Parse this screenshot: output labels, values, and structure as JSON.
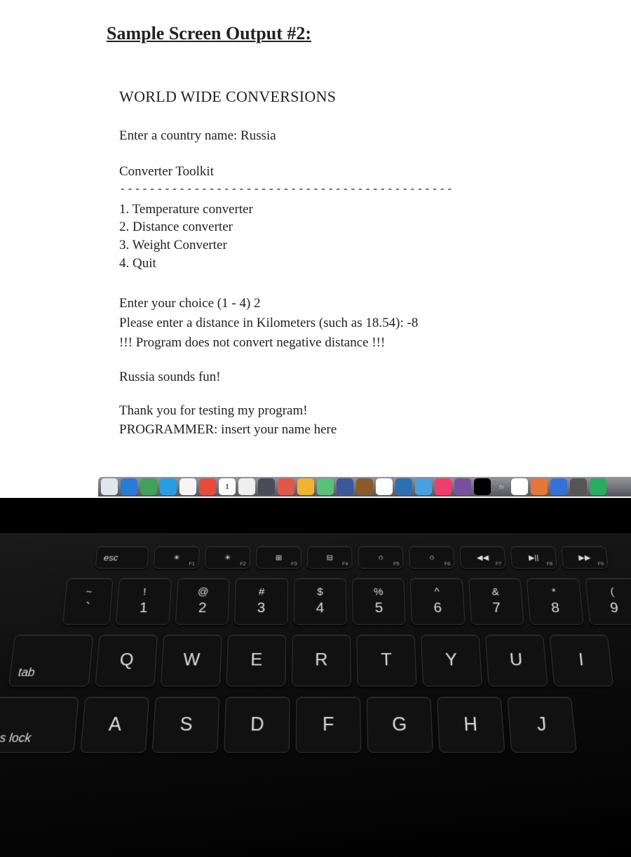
{
  "doc": {
    "title": "Sample Screen Output #2:",
    "app_title": "WORLD WIDE CONVERSIONS",
    "prompt_country": "Enter a country name: Russia",
    "toolkit_header": "Converter Toolkit",
    "dashes": "---------------------------------------------",
    "menu": [
      "1. Temperature converter",
      "2. Distance converter",
      "3. Weight Converter",
      "4. Quit"
    ],
    "choice_line": "Enter your choice (1 - 4) 2",
    "distance_prompt": "Please enter a distance in Kilometers (such as 18.54): -8",
    "error_line": "!!! Program does not convert negative distance !!!",
    "fun_line": "Russia sounds fun!",
    "thanks_line": "Thank you for testing my program!",
    "programmer_line": "PROGRAMMER: insert your name here"
  },
  "dock": {
    "tv_label": "tv",
    "icons": [
      {
        "bg": "#dfe6ee"
      },
      {
        "bg": "#2a7bd6"
      },
      {
        "bg": "#3fa15a"
      },
      {
        "bg": "#2a9de0"
      },
      {
        "bg": "#f5f5f5"
      },
      {
        "bg": "#e84b3c"
      },
      {
        "bg": "#fff",
        "txt": "1"
      },
      {
        "bg": "#eee"
      },
      {
        "bg": "#4a4a58"
      },
      {
        "bg": "#e2574c"
      },
      {
        "bg": "#f2b330"
      },
      {
        "bg": "#59c178"
      },
      {
        "bg": "#3b5998"
      },
      {
        "bg": "#8b5a2b"
      },
      {
        "bg": "#fff"
      },
      {
        "bg": "#2c6fb3"
      },
      {
        "bg": "#48a0dc"
      },
      {
        "bg": "#ef3e6d"
      },
      {
        "bg": "#7a4fa0"
      },
      {
        "bg": "#000"
      },
      {
        "bg": "#fff"
      },
      {
        "bg": "#e57838"
      },
      {
        "bg": "#3672d6"
      },
      {
        "bg": "#555"
      },
      {
        "bg": "#2aad5e"
      }
    ]
  },
  "keyboard": {
    "fn_row": [
      {
        "main": "esc",
        "sub": "",
        "cls": "esc"
      },
      {
        "main": "☀",
        "sub": "F1"
      },
      {
        "main": "☀",
        "sub": "F2"
      },
      {
        "main": "⊞",
        "sub": "F3"
      },
      {
        "main": "⊟",
        "sub": "F4"
      },
      {
        "main": "☼",
        "sub": "F5"
      },
      {
        "main": "☼",
        "sub": "F6"
      },
      {
        "main": "◀◀",
        "sub": "F7"
      },
      {
        "main": "▶||",
        "sub": "F8"
      },
      {
        "main": "▶▶",
        "sub": "F9"
      }
    ],
    "num_row": [
      {
        "upper": "~",
        "lower": "`",
        "cls": "tilde"
      },
      {
        "upper": "!",
        "lower": "1"
      },
      {
        "upper": "@",
        "lower": "2"
      },
      {
        "upper": "#",
        "lower": "3"
      },
      {
        "upper": "$",
        "lower": "4"
      },
      {
        "upper": "%",
        "lower": "5"
      },
      {
        "upper": "^",
        "lower": "6"
      },
      {
        "upper": "&",
        "lower": "7"
      },
      {
        "upper": "*",
        "lower": "8"
      },
      {
        "upper": "(",
        "lower": "9"
      }
    ],
    "q_row": [
      {
        "main": "tab",
        "cls": "tab"
      },
      {
        "main": "Q"
      },
      {
        "main": "W"
      },
      {
        "main": "E"
      },
      {
        "main": "R"
      },
      {
        "main": "T"
      },
      {
        "main": "Y"
      },
      {
        "main": "U"
      },
      {
        "main": "I"
      }
    ],
    "a_row": [
      {
        "main": "caps lock",
        "cls": "caps"
      },
      {
        "main": "A"
      },
      {
        "main": "S"
      },
      {
        "main": "D"
      },
      {
        "main": "F"
      },
      {
        "main": "G"
      },
      {
        "main": "H"
      },
      {
        "main": "J"
      }
    ]
  }
}
